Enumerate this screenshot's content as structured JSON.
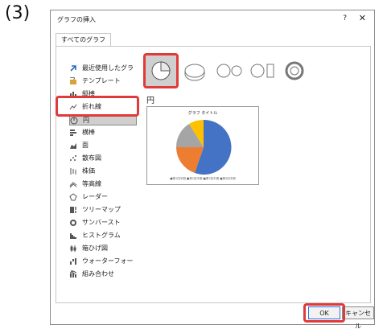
{
  "step_label": "(3)",
  "dialog": {
    "title": "グラフの挿入",
    "help": "?",
    "close": "✕",
    "tab": "すべてのグラフ"
  },
  "sidebar": {
    "items": [
      {
        "label": "最近使用したグラフ",
        "icon": "recent-icon"
      },
      {
        "label": "テンプレート",
        "icon": "folder-icon"
      },
      {
        "label": "縦棒",
        "icon": "column-chart-icon"
      },
      {
        "label": "折れ線",
        "icon": "line-chart-icon"
      },
      {
        "label": "円",
        "icon": "pie-chart-icon",
        "selected": true
      },
      {
        "label": "横棒",
        "icon": "bar-chart-icon"
      },
      {
        "label": "面",
        "icon": "area-chart-icon"
      },
      {
        "label": "散布図",
        "icon": "scatter-chart-icon"
      },
      {
        "label": "株価",
        "icon": "stock-chart-icon"
      },
      {
        "label": "等高線",
        "icon": "surface-chart-icon"
      },
      {
        "label": "レーダー",
        "icon": "radar-chart-icon"
      },
      {
        "label": "ツリーマップ",
        "icon": "treemap-icon"
      },
      {
        "label": "サンバースト",
        "icon": "sunburst-icon"
      },
      {
        "label": "ヒストグラム",
        "icon": "histogram-icon"
      },
      {
        "label": "箱ひげ図",
        "icon": "boxwhisker-icon"
      },
      {
        "label": "ウォーターフォール",
        "icon": "waterfall-icon"
      },
      {
        "label": "組み合わせ",
        "icon": "combo-icon"
      }
    ]
  },
  "main": {
    "section_title": "円",
    "preview": {
      "title": "グラフ タイトル",
      "legend": "■第1四半期 ■第2四半期 ■第3四半期 ■第4四半期"
    }
  },
  "footer": {
    "ok": "OK",
    "cancel": "キャンセル"
  },
  "colors": {
    "highlight": "#e03a3a",
    "pie": [
      "#4472c4",
      "#ed7d31",
      "#a5a5a5",
      "#ffc000"
    ]
  }
}
